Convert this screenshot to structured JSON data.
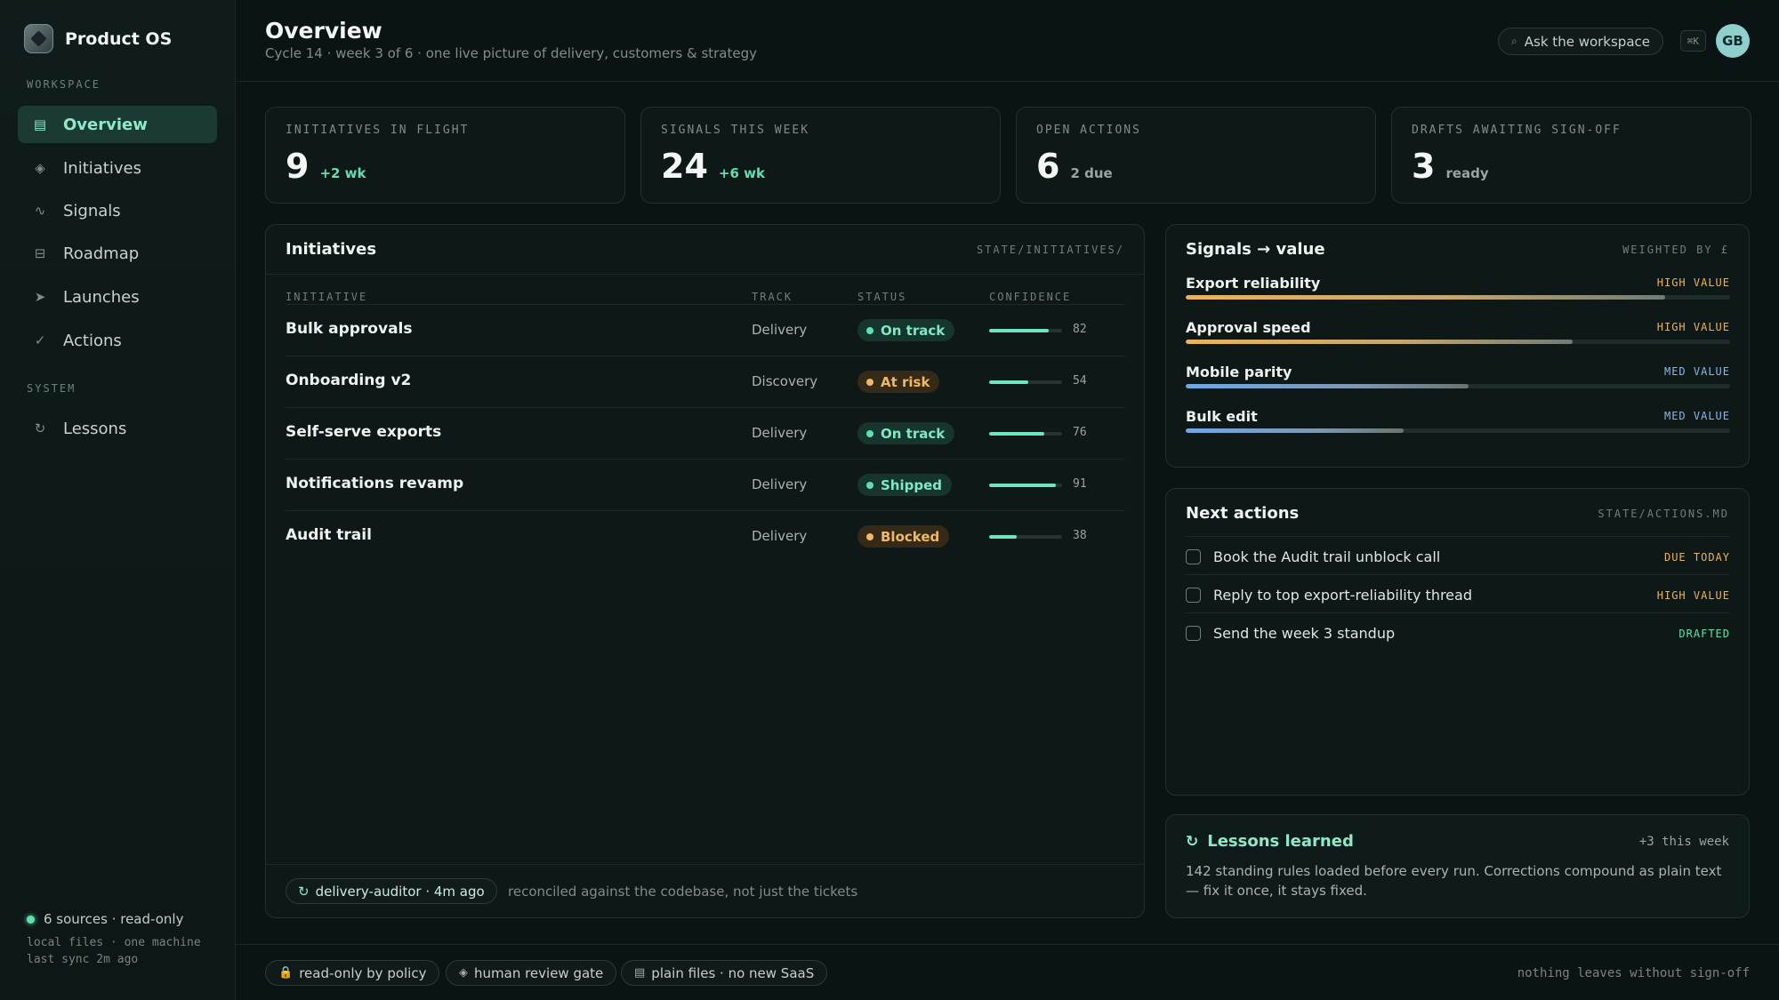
{
  "brand": {
    "name": "Product OS"
  },
  "sidebar": {
    "workspace_label": "WORKSPACE",
    "system_label": "SYSTEM",
    "items": [
      {
        "label": "Overview",
        "icon": "grid-icon",
        "glyph": "▤"
      },
      {
        "label": "Initiatives",
        "icon": "diamond-icon",
        "glyph": "◈"
      },
      {
        "label": "Signals",
        "icon": "wave-icon",
        "glyph": "∿"
      },
      {
        "label": "Roadmap",
        "icon": "roadmap-icon",
        "glyph": "⊟"
      },
      {
        "label": "Launches",
        "icon": "send-icon",
        "glyph": "➤"
      },
      {
        "label": "Actions",
        "icon": "check-icon",
        "glyph": "✓"
      }
    ],
    "system_items": [
      {
        "label": "Lessons",
        "icon": "loop-icon",
        "glyph": "↻"
      }
    ],
    "footer": {
      "sources": "6 sources · read-only",
      "line1": "local files · one machine",
      "line2": "last sync 2m ago"
    }
  },
  "header": {
    "title": "Overview",
    "subtitle": "Cycle 14 · week 3 of 6 · one live picture of delivery, customers & strategy",
    "ask_label": "Ask the workspace",
    "shortcut": "⌘K",
    "avatar_initials": "GB"
  },
  "kpis": [
    {
      "label": "INITIATIVES IN FLIGHT",
      "value": "9",
      "delta": "+2 wk"
    },
    {
      "label": "SIGNALS THIS WEEK",
      "value": "24",
      "delta": "+6 wk"
    },
    {
      "label": "OPEN ACTIONS",
      "value": "6",
      "delta": "2 due"
    },
    {
      "label": "DRAFTS AWAITING SIGN-OFF",
      "value": "3",
      "delta": "ready"
    }
  ],
  "initiatives": {
    "title": "Initiatives",
    "tag": "STATE/INITIATIVES/",
    "columns": {
      "initiative": "INITIATIVE",
      "track": "TRACK",
      "status": "STATUS",
      "confidence": "CONFIDENCE"
    },
    "rows": [
      {
        "name": "Bulk approvals",
        "track": "Delivery",
        "status": "On track",
        "tone": "good",
        "confidence": 82
      },
      {
        "name": "Onboarding v2",
        "track": "Discovery",
        "status": "At risk",
        "tone": "warn",
        "confidence": 54
      },
      {
        "name": "Self-serve exports",
        "track": "Delivery",
        "status": "On track",
        "tone": "good",
        "confidence": 76
      },
      {
        "name": "Notifications revamp",
        "track": "Delivery",
        "status": "Shipped",
        "tone": "good",
        "confidence": 91
      },
      {
        "name": "Audit trail",
        "track": "Delivery",
        "status": "Blocked",
        "tone": "warn",
        "confidence": 38
      }
    ],
    "auditor": "delivery-auditor · 4m ago",
    "auditor_note": "reconciled against the codebase, not just the tickets"
  },
  "signals": {
    "title": "Signals → value",
    "tag": "WEIGHTED BY £",
    "items": [
      {
        "name": "Export reliability",
        "badge": "HIGH VALUE",
        "level": "high",
        "fill": 0.88
      },
      {
        "name": "Approval speed",
        "badge": "HIGH VALUE",
        "level": "high",
        "fill": 0.71
      },
      {
        "name": "Mobile parity",
        "badge": "MED VALUE",
        "level": "med",
        "fill": 0.52
      },
      {
        "name": "Bulk edit",
        "badge": "MED VALUE",
        "level": "med",
        "fill": 0.4
      }
    ]
  },
  "actions": {
    "title": "Next actions",
    "tag": "STATE/ACTIONS.MD",
    "items": [
      {
        "text": "Book the Audit trail unblock call",
        "badge": "DUE TODAY",
        "tone": "due"
      },
      {
        "text": "Reply to top export-reliability thread",
        "badge": "HIGH VALUE",
        "tone": "due"
      },
      {
        "text": "Send the week 3 standup",
        "badge": "DRAFTED",
        "tone": "drafted"
      }
    ]
  },
  "lessons": {
    "title": "Lessons learned",
    "count": "+3 this week",
    "body": "142 standing rules loaded before every run. Corrections compound as plain text — fix it once, it stays fixed."
  },
  "footer": {
    "chips": [
      {
        "label": "read-only by policy",
        "icon": "lock-icon",
        "glyph": "🔒"
      },
      {
        "label": "human review gate",
        "icon": "diamond-icon",
        "glyph": "◈"
      },
      {
        "label": "plain files · no new SaaS",
        "icon": "file-icon",
        "glyph": "▤"
      }
    ],
    "note": "nothing leaves without sign-off"
  },
  "colors": {
    "accent": "#5fe0b0",
    "warn": "#f1b866",
    "high": "#e9b35e",
    "med": "#8ab8e8"
  }
}
